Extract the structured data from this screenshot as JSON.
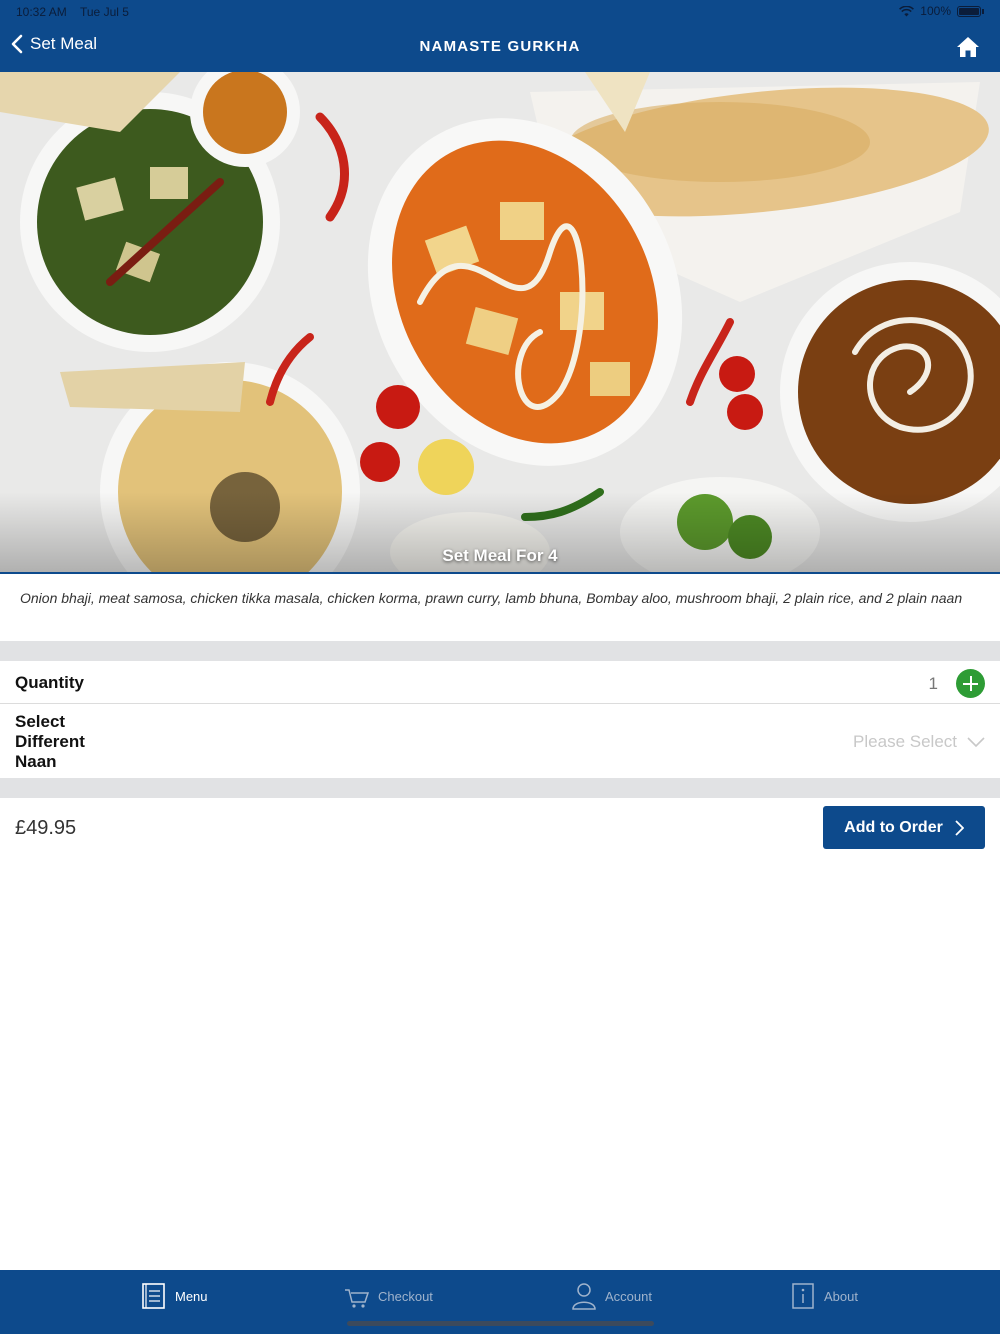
{
  "status_bar": {
    "time": "10:32 AM",
    "date": "Tue Jul 5",
    "battery": "100%"
  },
  "nav": {
    "back_label": "Set Meal",
    "title": "NAMASTE GURKHA"
  },
  "hero": {
    "caption": "Set Meal For 4"
  },
  "description": "Onion bhaji, meat samosa, chicken tikka masala, chicken korma, prawn curry, lamb bhuna, Bombay aloo, mushroom bhaji, 2 plain rice, and 2 plain naan",
  "quantity": {
    "label": "Quantity",
    "value": "1"
  },
  "naan": {
    "label": "Select Different Naan",
    "placeholder": "Please Select"
  },
  "order": {
    "price": "£49.95",
    "button_label": "Add to Order"
  },
  "tabs": [
    {
      "label": "Menu",
      "icon": "menu-icon",
      "active": true
    },
    {
      "label": "Checkout",
      "icon": "cart-icon",
      "active": false
    },
    {
      "label": "Account",
      "icon": "person-icon",
      "active": false
    },
    {
      "label": "About",
      "icon": "info-icon",
      "active": false
    }
  ],
  "colors": {
    "primary": "#0d4a8c",
    "add_green": "#2e9c35",
    "separator": "#e1e2e4"
  }
}
